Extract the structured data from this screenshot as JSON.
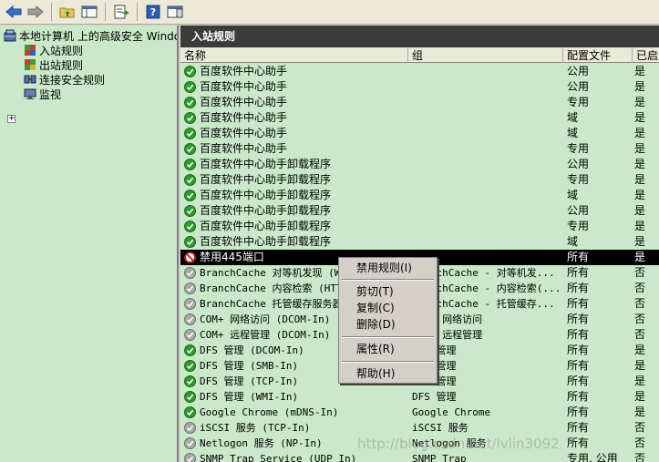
{
  "toolbar": {
    "buttons": [
      {
        "icon": "back-arrow-icon"
      },
      {
        "icon": "forward-arrow-icon"
      },
      {
        "icon": "up-folder-icon"
      },
      {
        "icon": "show-hide-tree-icon"
      },
      {
        "icon": "export-list-icon"
      },
      {
        "icon": "help-icon"
      },
      {
        "icon": "action-pane-icon"
      }
    ]
  },
  "tree": {
    "root": "本地计算机 上的高级安全 Windows",
    "items": [
      "入站规则",
      "出站规则",
      "连接安全规则",
      "监视"
    ],
    "expander": "+"
  },
  "pane": {
    "title": "入站规则",
    "columns": [
      "名称",
      "组",
      "配置文件",
      "已启用"
    ]
  },
  "rules": [
    {
      "name": "百度软件中心助手",
      "group": "",
      "profile": "公用",
      "enabled": "是",
      "status": "enabled"
    },
    {
      "name": "百度软件中心助手",
      "group": "",
      "profile": "公用",
      "enabled": "是",
      "status": "enabled"
    },
    {
      "name": "百度软件中心助手",
      "group": "",
      "profile": "专用",
      "enabled": "是",
      "status": "enabled"
    },
    {
      "name": "百度软件中心助手",
      "group": "",
      "profile": "域",
      "enabled": "是",
      "status": "enabled"
    },
    {
      "name": "百度软件中心助手",
      "group": "",
      "profile": "域",
      "enabled": "是",
      "status": "enabled"
    },
    {
      "name": "百度软件中心助手",
      "group": "",
      "profile": "专用",
      "enabled": "是",
      "status": "enabled"
    },
    {
      "name": "百度软件中心助手卸载程序",
      "group": "",
      "profile": "公用",
      "enabled": "是",
      "status": "enabled"
    },
    {
      "name": "百度软件中心助手卸载程序",
      "group": "",
      "profile": "专用",
      "enabled": "是",
      "status": "enabled"
    },
    {
      "name": "百度软件中心助手卸载程序",
      "group": "",
      "profile": "域",
      "enabled": "是",
      "status": "enabled"
    },
    {
      "name": "百度软件中心助手卸载程序",
      "group": "",
      "profile": "公用",
      "enabled": "是",
      "status": "enabled"
    },
    {
      "name": "百度软件中心助手卸载程序",
      "group": "",
      "profile": "专用",
      "enabled": "是",
      "status": "enabled"
    },
    {
      "name": "百度软件中心助手卸载程序",
      "group": "",
      "profile": "域",
      "enabled": "是",
      "status": "enabled"
    },
    {
      "name": "禁用445端口",
      "group": "",
      "profile": "所有",
      "enabled": "是",
      "status": "blocked",
      "selected": true
    },
    {
      "name": "BranchCache 对等机发现 (WSD-In)",
      "group": "BranchCache - 对等机发...",
      "profile": "所有",
      "enabled": "否",
      "status": "disabled",
      "mono": true
    },
    {
      "name": "BranchCache 内容检索 (HTTP-In)",
      "group": "BranchCache - 内容检索(...",
      "profile": "所有",
      "enabled": "否",
      "status": "disabled",
      "mono": true
    },
    {
      "name": "BranchCache 托管缓存服务器(HTTP-In)",
      "group": "BranchCache - 托管缓存...",
      "profile": "所有",
      "enabled": "否",
      "status": "disabled",
      "mono": true
    },
    {
      "name": "COM+ 网络访问 (DCOM-In)",
      "group": "COM+ 网络访问",
      "profile": "所有",
      "enabled": "否",
      "status": "disabled",
      "mono": true
    },
    {
      "name": "COM+ 远程管理 (DCOM-In)",
      "group": "COM+ 远程管理",
      "profile": "所有",
      "enabled": "否",
      "status": "disabled",
      "mono": true
    },
    {
      "name": "DFS 管理 (DCOM-In)",
      "group": "DFS 管理",
      "profile": "所有",
      "enabled": "是",
      "status": "enabled",
      "mono": true
    },
    {
      "name": "DFS 管理 (SMB-In)",
      "group": "DFS 管理",
      "profile": "所有",
      "enabled": "是",
      "status": "enabled",
      "mono": true
    },
    {
      "name": "DFS 管理 (TCP-In)",
      "group": "DFS 管理",
      "profile": "所有",
      "enabled": "是",
      "status": "enabled",
      "mono": true
    },
    {
      "name": "DFS 管理 (WMI-In)",
      "group": "DFS 管理",
      "profile": "所有",
      "enabled": "是",
      "status": "enabled",
      "mono": true
    },
    {
      "name": "Google Chrome (mDNS-In)",
      "group": "Google Chrome",
      "profile": "所有",
      "enabled": "是",
      "status": "enabled",
      "mono": true
    },
    {
      "name": "iSCSI 服务 (TCP-In)",
      "group": "iSCSI 服务",
      "profile": "所有",
      "enabled": "否",
      "status": "disabled",
      "mono": true
    },
    {
      "name": "Netlogon 服务 (NP-In)",
      "group": "Netlogon 服务",
      "profile": "所有",
      "enabled": "否",
      "status": "disabled",
      "mono": true
    },
    {
      "name": "SNMP Trap Service (UDP In)",
      "group": "SNMP Trap",
      "profile": "专用, 公用",
      "enabled": "否",
      "status": "disabled",
      "mono": true
    }
  ],
  "context_menu": {
    "items": [
      "禁用规则(I)",
      "剪切(T)",
      "复制(C)",
      "删除(D)",
      "属性(R)",
      "帮助(H)"
    ]
  },
  "watermark": "http://blog.csdn.net/lvlin3092"
}
